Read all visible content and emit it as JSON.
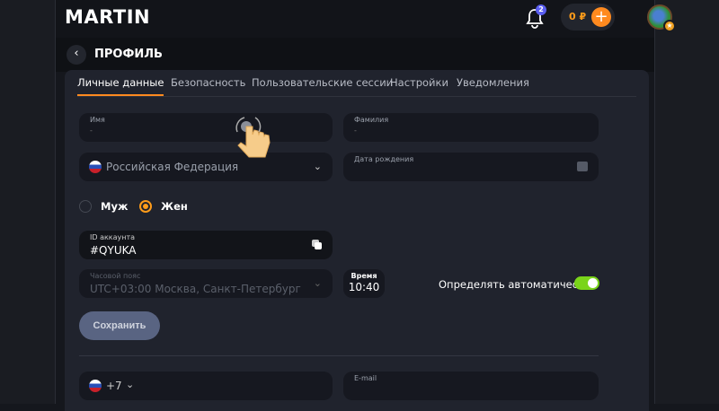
{
  "header": {
    "logo": "MARTIN",
    "notifications": "2",
    "balance": "0 ₽"
  },
  "page": {
    "title": "ПРОФИЛЬ"
  },
  "tabs": [
    {
      "label": "Личные данные",
      "active": true
    },
    {
      "label": "Безопасность"
    },
    {
      "label": "Пользовательские сессии"
    },
    {
      "label": "Настройки"
    },
    {
      "label": "Уведомления"
    }
  ],
  "form": {
    "first_name": {
      "label": "Имя",
      "value": "-"
    },
    "last_name": {
      "label": "Фамилия",
      "value": "-"
    },
    "country": {
      "value": "Российская Федерация"
    },
    "birthdate": {
      "label": "Дата рождения"
    },
    "gender": {
      "options": [
        "Муж",
        "Жен"
      ],
      "selected": "Жен"
    },
    "account_id": {
      "label": "ID аккаунта",
      "value": "#QYUKA"
    },
    "timezone": {
      "label": "Часовой пояс",
      "value": "UTC+03:00 Москва, Санкт-Петербург"
    },
    "time": {
      "label": "Время",
      "value": "10:40"
    },
    "auto_detect": {
      "label": "Определять автоматически",
      "on": true
    },
    "save": "Сохранить",
    "phone_code": "+7",
    "email": {
      "label": "E-mail"
    }
  },
  "colors": {
    "accent": "#ff8a1f",
    "toggle": "#7ad41a"
  }
}
